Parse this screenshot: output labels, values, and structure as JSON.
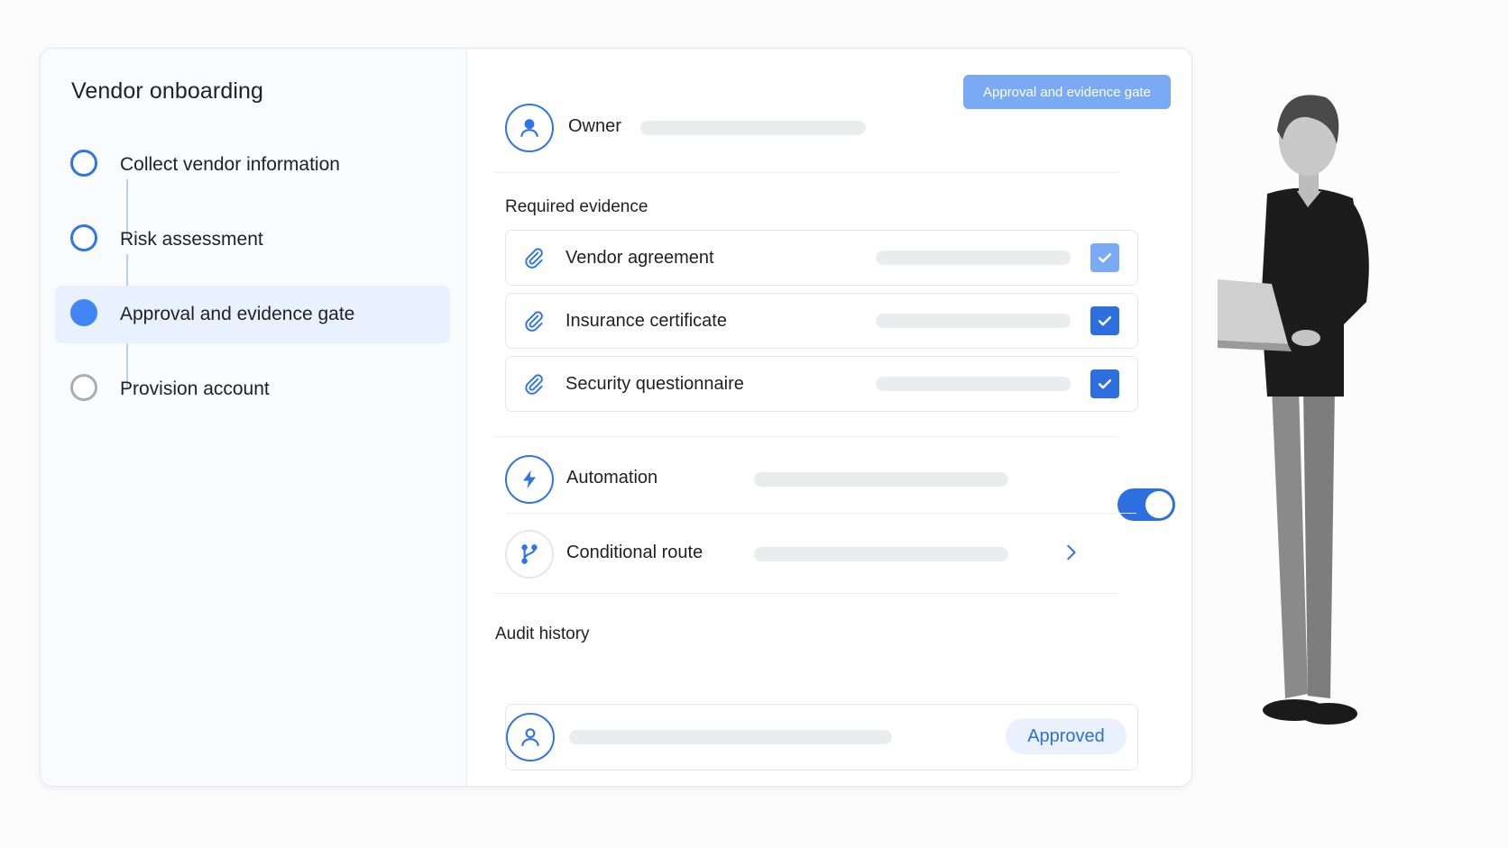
{
  "sidebar": {
    "title": "Vendor onboarding",
    "steps": [
      {
        "label": "Collect vendor information",
        "state": "incomplete"
      },
      {
        "label": "Risk assessment",
        "state": "incomplete"
      },
      {
        "label": "Approval and evidence gate",
        "state": "current"
      },
      {
        "label": "Provision account",
        "state": "pending"
      }
    ]
  },
  "detail": {
    "gate_button": "Approval and evidence gate",
    "owner_label": "Owner",
    "evidence_title": "Required evidence",
    "evidence": [
      {
        "label": "Vendor agreement",
        "checked": true
      },
      {
        "label": "Insurance certificate",
        "checked": true
      },
      {
        "label": "Security questionnaire",
        "checked": true
      }
    ],
    "automation_label": "Automation",
    "automation_on": true,
    "conditional_label": "Conditional route",
    "audit_title": "Audit history",
    "audit_status": "Approved"
  },
  "colors": {
    "accent": "#2e6fe0",
    "accent_light": "#7aaaf3",
    "active_bg": "#e9f1fe"
  },
  "icons": [
    "user-icon",
    "paperclip-icon",
    "check-icon",
    "lightning-icon",
    "branch-icon",
    "chevron-right-icon"
  ]
}
